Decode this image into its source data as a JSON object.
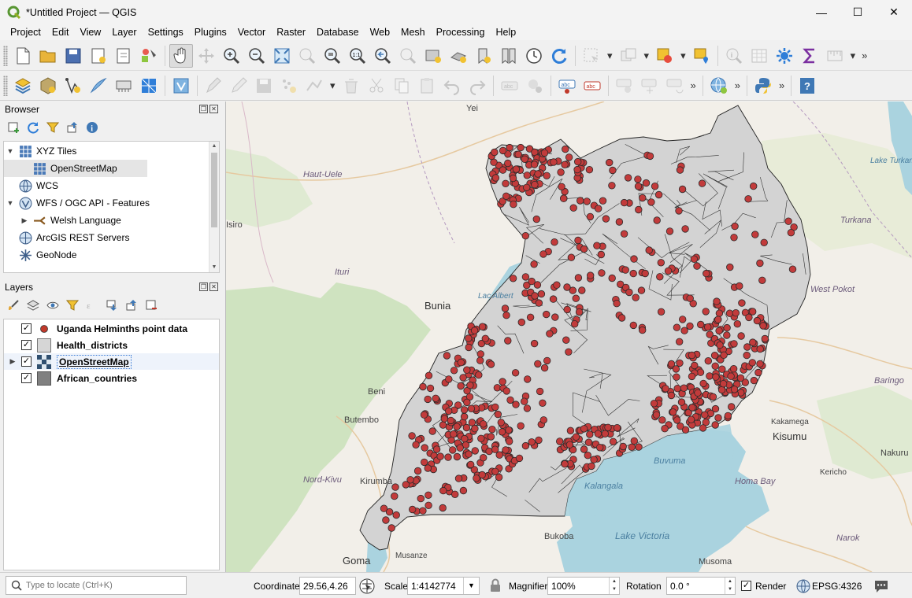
{
  "window": {
    "title": "*Untitled Project — QGIS",
    "controls": {
      "minimize": "—",
      "maximize": "☐",
      "close": "✕"
    }
  },
  "menubar": [
    "Project",
    "Edit",
    "View",
    "Layer",
    "Settings",
    "Plugins",
    "Vector",
    "Raster",
    "Database",
    "Web",
    "Mesh",
    "Processing",
    "Help"
  ],
  "toolbars": {
    "row1_icons": [
      "new-project-icon",
      "open-project-icon",
      "save-project-icon",
      "new-print-layout-icon",
      "layout-manager-icon",
      "style-manager-icon",
      "pan-icon",
      "pan-to-selection-icon",
      "zoom-in-icon",
      "zoom-out-icon",
      "zoom-full-icon",
      "zoom-to-selection-icon",
      "zoom-to-layer-icon",
      "zoom-native-icon",
      "zoom-last-icon",
      "zoom-next-icon",
      "new-map-view-icon",
      "new-3d-map-icon",
      "new-bookmark-icon",
      "show-bookmarks-icon",
      "temporal-controller-icon",
      "refresh-icon",
      "select-features-icon",
      "deselect-features-icon",
      "deselect-all-icon",
      "select-by-location-icon",
      "identify-icon",
      "attribute-table-icon",
      "settings-gear-icon",
      "statistics-sum-icon",
      "measure-icon"
    ],
    "row2_icons": [
      "data-source-manager-icon",
      "new-geopackage-icon",
      "digitizing-icon",
      "new-shapefile-icon",
      "new-virtual-layer-icon",
      "new-mesh-icon",
      "toggle-editing-icon",
      "edit-pencil-icon",
      "save-edits-icon",
      "add-feature-icon",
      "vertex-tool-icon",
      "delete-selected-icon",
      "cut-features-icon",
      "copy-features-icon",
      "paste-features-icon",
      "undo-icon",
      "redo-icon",
      "label-tool-icon",
      "pin-labels-icon",
      "label-toolbar-icon",
      "label-abc-icon",
      "show-hide-labels-icon",
      "move-label-icon",
      "rotate-label-icon",
      "change-label-icon",
      "metasearch-icon",
      "python-console-icon",
      "help-icon"
    ],
    "overflow": "»"
  },
  "browser": {
    "title": "Browser",
    "items": [
      {
        "label": "XYZ Tiles",
        "expanded": true,
        "icon": "xyz-tiles-icon"
      },
      {
        "label": "OpenStreetMap",
        "child": true,
        "icon": "osm-tiles-icon"
      },
      {
        "label": "WCS",
        "icon": "wcs-globe-icon"
      },
      {
        "label": "WFS / OGC API - Features",
        "expanded": true,
        "icon": "wfs-globe-icon"
      },
      {
        "label": "Welsh Language",
        "child": true,
        "icon": "wfs-connection-icon"
      },
      {
        "label": "ArcGIS REST Servers",
        "icon": "arcgis-globe-icon"
      },
      {
        "label": "GeoNode",
        "icon": "geonode-icon"
      }
    ]
  },
  "layers": {
    "title": "Layers",
    "items": [
      {
        "label": "Uganda Helminths point data",
        "checked": true,
        "symbol": "point",
        "color": "#c0392b"
      },
      {
        "label": "Health_districts",
        "checked": true,
        "symbol": "polygon",
        "color": "#d6d6d6"
      },
      {
        "label": "OpenStreetMap",
        "checked": true,
        "symbol": "raster",
        "selected": true,
        "expandable": true
      },
      {
        "label": "African_countries",
        "checked": true,
        "symbol": "polygon",
        "color": "#808080"
      }
    ]
  },
  "map": {
    "labels": [
      "Yei",
      "Haut-Uele",
      "Ituri",
      "Bunia",
      "Lac Albert",
      "Beni",
      "Butembo",
      "Nord-Kivu",
      "Kirumba",
      "Goma",
      "Musanze",
      "Bukoba",
      "Lake Victoria",
      "Kalangala",
      "Buvuma",
      "Homa Bay",
      "Kisumu",
      "Kakamega",
      "Kericho",
      "Nakuru",
      "Narok",
      "Musoma",
      "Turkana",
      "Lake Turkana",
      "West Pokot",
      "Baringo",
      "Isiro"
    ],
    "colors": {
      "country_fill": "#d3d3d3",
      "point_fill": "#c23b3b",
      "water": "#aad3df",
      "forest": "#cfe3c0",
      "land": "#f2efe9"
    }
  },
  "statusbar": {
    "locator_placeholder": "Type to locate (Ctrl+K)",
    "coordinate_label": "Coordinate",
    "coordinate_value": "29.56,4.26",
    "scale_label": "Scale",
    "scale_value": "1:4142774",
    "magnifier_label": "Magnifier",
    "magnifier_value": "100%",
    "rotation_label": "Rotation",
    "rotation_value": "0.0 °",
    "render_label": "Render",
    "render_checked": true,
    "crs": "EPSG:4326"
  }
}
